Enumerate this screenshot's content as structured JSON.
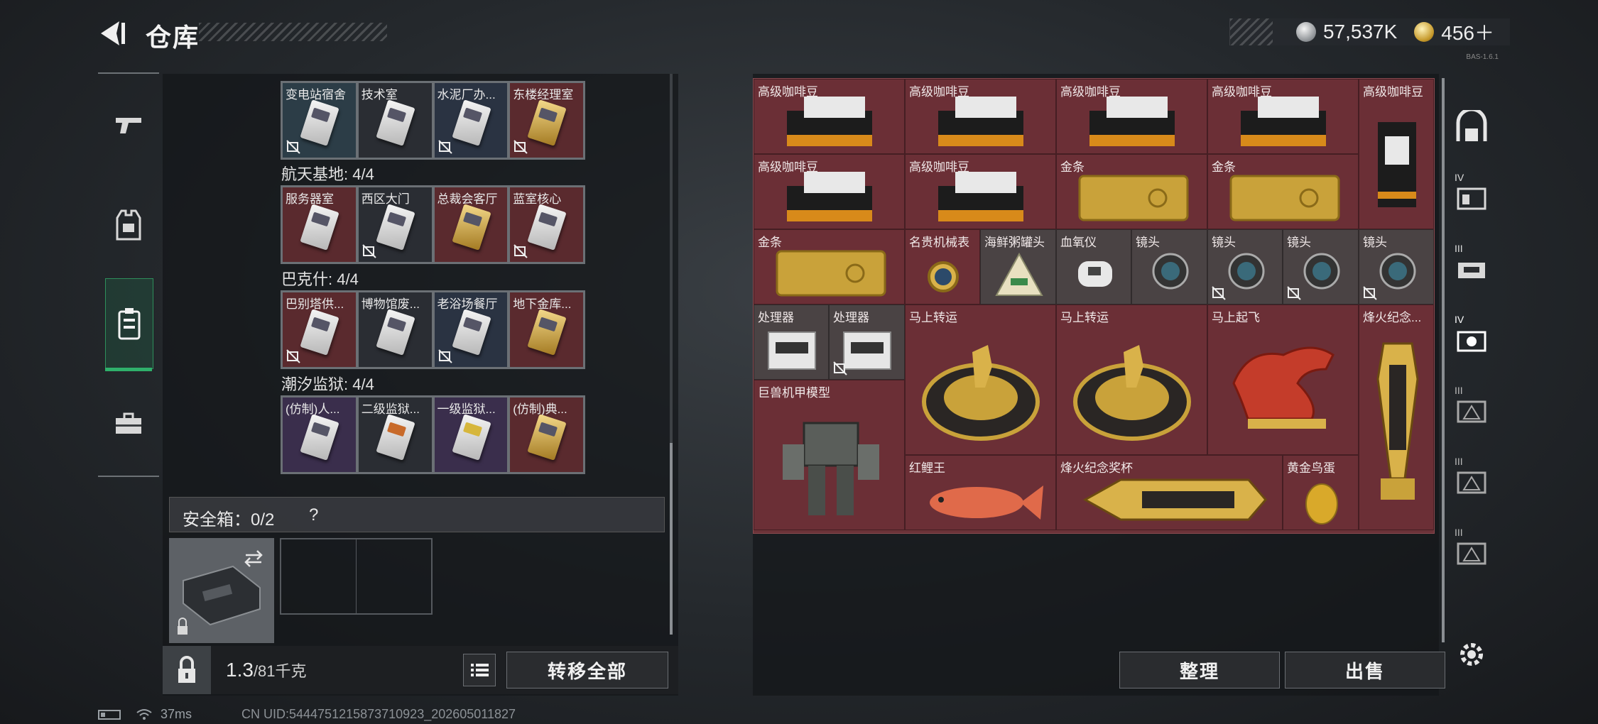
{
  "header": {
    "title": "仓库",
    "silver_value": "57,537K",
    "gold_value": "456＋",
    "version": "BAS-1.6.1"
  },
  "left_nav": [
    {
      "name": "weapons",
      "icon": "pistol-icon"
    },
    {
      "name": "armor",
      "icon": "armor-vest-icon"
    },
    {
      "name": "keycards",
      "icon": "keycard-holder-icon",
      "selected": true
    },
    {
      "name": "equipment",
      "icon": "briefcase-icon"
    }
  ],
  "keycards": {
    "row0": [
      "变电站宿舍",
      "技术室",
      "水泥厂办...",
      "东楼经理室"
    ],
    "group1": {
      "title": "航天基地: 4/4",
      "items": [
        "服务器室",
        "西区大门",
        "总裁会客厅",
        "蓝室核心"
      ]
    },
    "group2": {
      "title": "巴克什: 4/4",
      "items": [
        "巴别塔供...",
        "博物馆废...",
        "老浴场餐厅",
        "地下金库..."
      ]
    },
    "group3": {
      "title": "潮汐监狱: 4/4",
      "items": [
        "(仿制)人...",
        "二级监狱...",
        "一级监狱...",
        "(仿制)典..."
      ]
    }
  },
  "safebox": {
    "label": "安全箱：0/2",
    "help": "?"
  },
  "bottom": {
    "weight_value": "1.3",
    "weight_capacity": "/81千克",
    "transfer_all": "转移全部"
  },
  "stash": {
    "items": [
      {
        "label": "高级咖啡豆"
      },
      {
        "label": "高级咖啡豆"
      },
      {
        "label": "高级咖啡豆"
      },
      {
        "label": "高级咖啡豆"
      },
      {
        "label": "高级咖啡豆"
      },
      {
        "label": "高级咖啡豆"
      },
      {
        "label": "高级咖啡豆"
      },
      {
        "label": "金条"
      },
      {
        "label": "金条"
      },
      {
        "label": "金条"
      },
      {
        "label": "名贵机械表"
      },
      {
        "label": "海鲜粥罐头"
      },
      {
        "label": "血氧仪"
      },
      {
        "label": "镜头"
      },
      {
        "label": "镜头"
      },
      {
        "label": "镜头"
      },
      {
        "label": "镜头"
      },
      {
        "label": "处理器"
      },
      {
        "label": "处理器"
      },
      {
        "label": "马上转运"
      },
      {
        "label": "马上转运"
      },
      {
        "label": "马上起飞"
      },
      {
        "label": "烽火纪念..."
      },
      {
        "label": "巨兽机甲模型"
      },
      {
        "label": "红鲤王"
      },
      {
        "label": "烽火纪念奖杯"
      },
      {
        "label": "黄金鸟蛋"
      }
    ]
  },
  "actions": {
    "organize": "整理",
    "sell": "出售"
  },
  "right_nav": [
    "IV",
    "III",
    "IV",
    "III",
    "III",
    "III"
  ],
  "status": {
    "ping": "37ms",
    "uid": "CN UID:5444751215873710923_202605011827"
  },
  "colors": {
    "slot_red": "#6b2f36",
    "slot_grey": "#4a4344",
    "accent_green": "#2fb06b"
  }
}
